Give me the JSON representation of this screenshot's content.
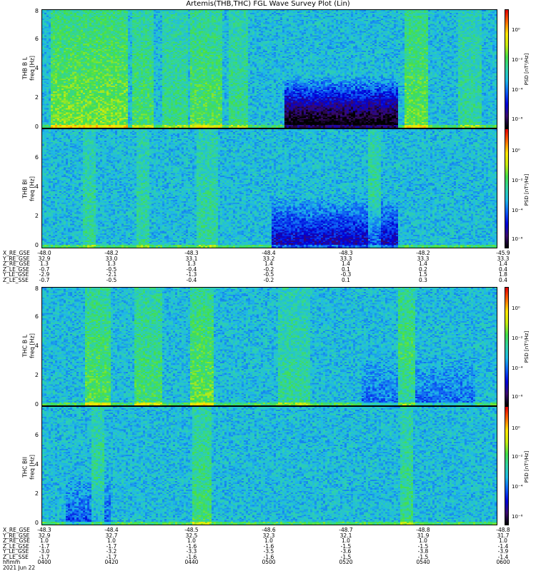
{
  "title": "Artemis(THB,THC) FGL Wave Survey Plot (Lin)",
  "chart_data": [
    {
      "type": "heatmap",
      "panel": "THB B L",
      "ylabel": "THB B L",
      "ylabel2": "freq [Hz]",
      "ylim": [
        0,
        8
      ],
      "yticks": [
        0,
        2,
        4,
        6,
        8
      ],
      "colorbar": {
        "label": "PSD [nT²/Hz]",
        "scale": "log",
        "ticks": [
          "10⁰",
          "10⁻²",
          "10⁻⁴",
          "10⁻⁶"
        ]
      }
    },
    {
      "type": "heatmap",
      "panel": "THB Bl",
      "ylabel": "THB Bl",
      "ylabel2": "freq [Hz]",
      "ylim": [
        0,
        8
      ],
      "yticks": [
        0,
        2,
        4,
        6
      ],
      "colorbar": {
        "label": "PSD [nT²/Hz]",
        "scale": "log",
        "ticks": [
          "10⁰",
          "10⁻²",
          "10⁻⁴",
          "10⁻⁶"
        ]
      }
    },
    {
      "type": "heatmap",
      "panel": "THC B L",
      "ylabel": "THC B L",
      "ylabel2": "freq [Hz]",
      "ylim": [
        0,
        8
      ],
      "yticks": [
        0,
        2,
        4,
        6,
        8
      ],
      "colorbar": {
        "label": "PSD [nT²/Hz]",
        "scale": "log",
        "ticks": [
          "10⁰",
          "10⁻²",
          "10⁻⁴",
          "10⁻⁶"
        ]
      }
    },
    {
      "type": "heatmap",
      "panel": "THC Bll",
      "ylabel": "THC Bll",
      "ylabel2": "freq [Hz]",
      "ylim": [
        0,
        8
      ],
      "yticks": [
        0,
        2,
        4,
        6
      ],
      "colorbar": {
        "label": "PSD [nT²/Hz]",
        "scale": "log",
        "ticks": [
          "10⁰",
          "10⁻²",
          "10⁻⁴",
          "10⁻⁶"
        ]
      }
    }
  ],
  "orbit_thb": {
    "rows": [
      {
        "label": "X_RE_GSE",
        "values": [
          "-48.0",
          "-48.2",
          "-48.3",
          "-48.4",
          "-48.3",
          "-48.2",
          "-45.9"
        ]
      },
      {
        "label": "Y_RE_GSE",
        "values": [
          "32.9",
          "33.0",
          "33.1",
          "33.2",
          "33.3",
          "33.3",
          "33.3"
        ]
      },
      {
        "label": "Z_RE_GSE",
        "values": [
          "1.3",
          "1.3",
          "1.3",
          "1.4",
          "1.4",
          "1.4",
          "1.4"
        ]
      },
      {
        "label": "Z_LE_GSE",
        "values": [
          "-0.7",
          "-0.5",
          "-0.4",
          "-0.2",
          "0.1",
          "0.2",
          "0.4"
        ]
      },
      {
        "label": "Y_LE_GSE",
        "values": [
          "-2.9",
          "-2.1",
          "-1.3",
          "-0.5",
          "-0.3",
          "1.5",
          "1.8"
        ]
      },
      {
        "label": "Z_LE_SSE",
        "values": [
          "-0.7",
          "-0.5",
          "-0.4",
          "-0.2",
          "0.1",
          "0.3",
          "0.4"
        ]
      }
    ]
  },
  "orbit_thc": {
    "rows": [
      {
        "label": "X_RE_GSE",
        "values": [
          "-48.3",
          "-48.4",
          "-48.5",
          "-48.6",
          "-48.7",
          "-48.8",
          "-48.8"
        ]
      },
      {
        "label": "Y_RE_GSE",
        "values": [
          "32.9",
          "32.7",
          "32.5",
          "32.3",
          "32.1",
          "31.9",
          "31.7"
        ]
      },
      {
        "label": "Z_RE_GSE",
        "values": [
          "1.0",
          "1.0",
          "1.0",
          "1.0",
          "1.0",
          "1.0",
          "1.0"
        ]
      },
      {
        "label": "Z_LE_GSE",
        "values": [
          "-1.7",
          "-1.7",
          "-1.6",
          "-1.6",
          "-1.5",
          "-1.5",
          "-1.4"
        ]
      },
      {
        "label": "Y_LE_GSE",
        "values": [
          "-3.0",
          "-3.2",
          "-3.3",
          "-3.5",
          "-3.6",
          "-3.8",
          "-3.9"
        ]
      },
      {
        "label": "Z_LE_SSE",
        "values": [
          "-1.7",
          "-1.7",
          "-1.6",
          "-1.6",
          "-1.5",
          "-1.5",
          "-1.4"
        ]
      },
      {
        "label": "hhmm",
        "values": [
          "0400",
          "0420",
          "0440",
          "0500",
          "0520",
          "0540",
          "0600"
        ]
      }
    ],
    "date": "2021 Jun 22"
  },
  "colors": {
    "colormap": [
      "#000000",
      "#3a0a6e",
      "#0000d8",
      "#0e5cf5",
      "#1fb9e6",
      "#2fd2a8",
      "#44e04a",
      "#c8ec10",
      "#ffe600",
      "#ff6a00",
      "#e00000"
    ]
  }
}
